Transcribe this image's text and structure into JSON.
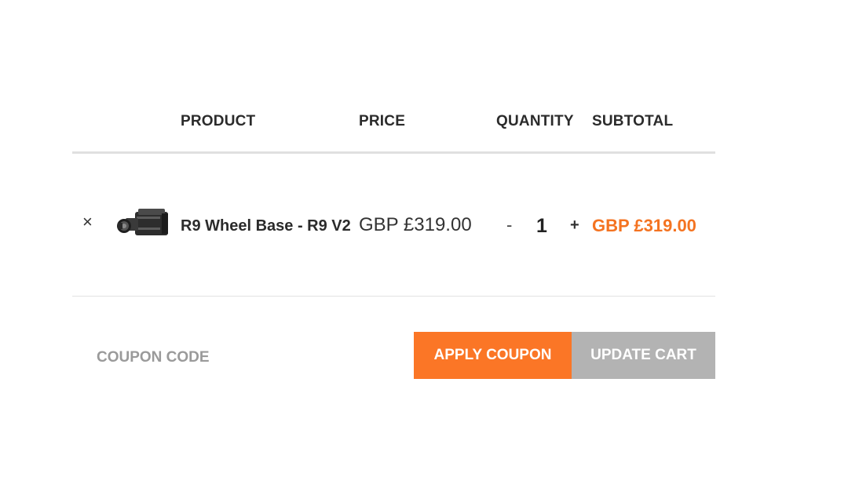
{
  "table": {
    "headers": {
      "product": "PRODUCT",
      "price": "PRICE",
      "quantity": "QUANTITY",
      "subtotal": "SUBTOTAL"
    },
    "items": [
      {
        "remove_symbol": "×",
        "image_icon": "wheel-base-thumbnail",
        "name": "R9 Wheel Base - R9 V2",
        "price": "GBP £319.00",
        "qty_minus": "-",
        "quantity": "1",
        "qty_plus": "+",
        "subtotal": "GBP £319.00"
      }
    ]
  },
  "coupon": {
    "placeholder": "COUPON CODE",
    "value": ""
  },
  "actions": {
    "apply_coupon_label": "APPLY COUPON",
    "update_cart_label": "UPDATE CART"
  },
  "colors": {
    "accent": "#fb7626",
    "subtotal_text": "#f47321",
    "update_button": "#b3b3b3"
  }
}
